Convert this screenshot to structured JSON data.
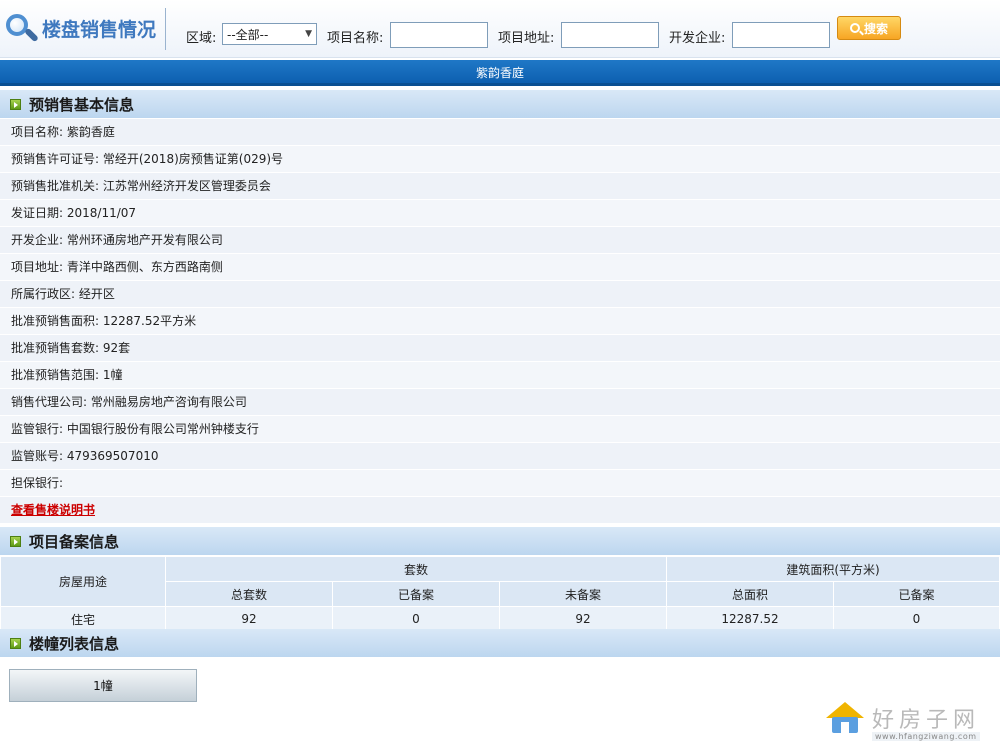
{
  "header": {
    "title": "楼盘销售情况",
    "district_label": "区域:",
    "district_value": "--全部--",
    "project_name_label": "项目名称:",
    "project_address_label": "项目地址:",
    "developer_label": "开发企业:",
    "search_label": "搜索",
    "colors": {
      "title": "#3f79bf",
      "search_button": "#f7a523"
    }
  },
  "project_title": "紫韵香庭",
  "presale_section": {
    "title": "预销售基本信息",
    "rows": [
      "项目名称: 紫韵香庭",
      "预销售许可证号: 常经开(2018)房预售证第(029)号",
      "预销售批准机关: 江苏常州经济开发区管理委员会",
      "发证日期: 2018/11/07",
      "开发企业: 常州环通房地产开发有限公司",
      "项目地址: 青洋中路西侧、东方西路南侧",
      "所属行政区: 经开区",
      "批准预销售面积: 12287.52平方米",
      "批准预销售套数: 92套",
      "批准预销售范围: 1幢",
      "销售代理公司: 常州融易房地产咨询有限公司",
      "监管银行: 中国银行股份有限公司常州钟楼支行",
      "监管账号: 479369507010",
      "担保银行:"
    ],
    "brochure_link": "查看售楼说明书"
  },
  "filing_section": {
    "title": "项目备案信息",
    "header_use": "房屋用途",
    "header_units": "套数",
    "header_area": "建筑面积(平方米)",
    "sub_headers": [
      "总套数",
      "已备案",
      "未备案",
      "总面积",
      "已备案"
    ],
    "rows": [
      {
        "use": "住宅",
        "values": [
          "92",
          "0",
          "92",
          "12287.52",
          "0"
        ]
      }
    ]
  },
  "building_section": {
    "title": "楼幢列表信息",
    "buildings": [
      "1幢"
    ]
  },
  "watermark": {
    "brand": "好房子网",
    "url": "www.hfangziwang.com"
  }
}
